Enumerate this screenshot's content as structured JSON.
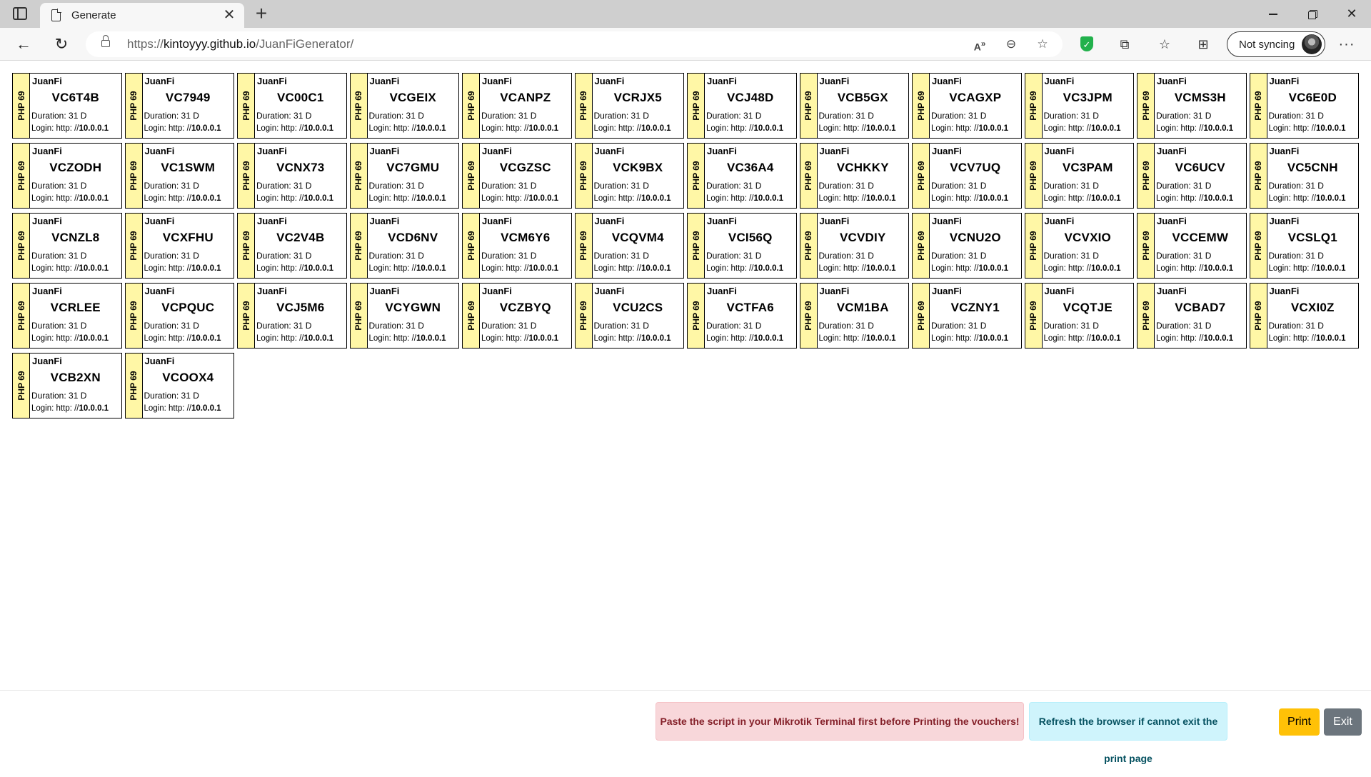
{
  "browser": {
    "tab_title": "Generate",
    "tab_close": "✕",
    "new_tab": "+",
    "url_scheme": "https://",
    "url_host": "kintoyyy.github.io",
    "url_path": "/JuanFiGenerator/",
    "profile_label": "Not syncing",
    "icons": [
      "sidebar-icon",
      "page-icon",
      "close-icon",
      "plus-icon",
      "back-arrow-icon",
      "reload-icon",
      "lock-icon",
      "read-aloud-icon",
      "zoom-out-icon",
      "add-favorite-icon",
      "shield-extension-icon",
      "extensions-icon",
      "favorites-icon",
      "collections-icon",
      "avatar",
      "more-menu-icon",
      "minimize-icon",
      "maximize-icon",
      "window-close-icon"
    ]
  },
  "voucher_template": {
    "brand": "JuanFi",
    "price": "PHP 69",
    "duration": "Duration: 31 D",
    "login_prefix": "Login: http: //",
    "login_ip": "10.0.0.1"
  },
  "vouchers": [
    "VC6T4B",
    "VC7949",
    "VC00C1",
    "VCGEIX",
    "VCANPZ",
    "VCRJX5",
    "VCJ48D",
    "VCB5GX",
    "VCAGXP",
    "VC3JPM",
    "VCMS3H",
    "VC6E0D",
    "VCZODH",
    "VC1SWM",
    "VCNX73",
    "VC7GMU",
    "VCGZSC",
    "VCK9BX",
    "VC36A4",
    "VCHKKY",
    "VCV7UQ",
    "VC3PAM",
    "VC6UCV",
    "VC5CNH",
    "VCNZL8",
    "VCXFHU",
    "VC2V4B",
    "VCD6NV",
    "VCM6Y6",
    "VCQVM4",
    "VCI56Q",
    "VCVDIY",
    "VCNU2O",
    "VCVXIO",
    "VCCEMW",
    "VCSLQ1",
    "VCRLEE",
    "VCPQUC",
    "VCJ5M6",
    "VCYGWN",
    "VCZBYQ",
    "VCU2CS",
    "VCTFA6",
    "VCM1BA",
    "VCZNY1",
    "VCQTJE",
    "VCBAD7",
    "VCXI0Z",
    "VCB2XN",
    "VCOOX4"
  ],
  "footer": {
    "warning": "Paste the script in your Mikrotik Terminal first before Printing the vouchers!",
    "info": "Refresh the browser if cannot exit the print page",
    "print_label": "Print",
    "exit_label": "Exit"
  },
  "colors": {
    "price_strip": "#fff7a6",
    "warning_bg": "#f8d7da",
    "info_bg": "#cff4fc",
    "print_btn": "#ffc107",
    "exit_btn": "#6c757d"
  }
}
